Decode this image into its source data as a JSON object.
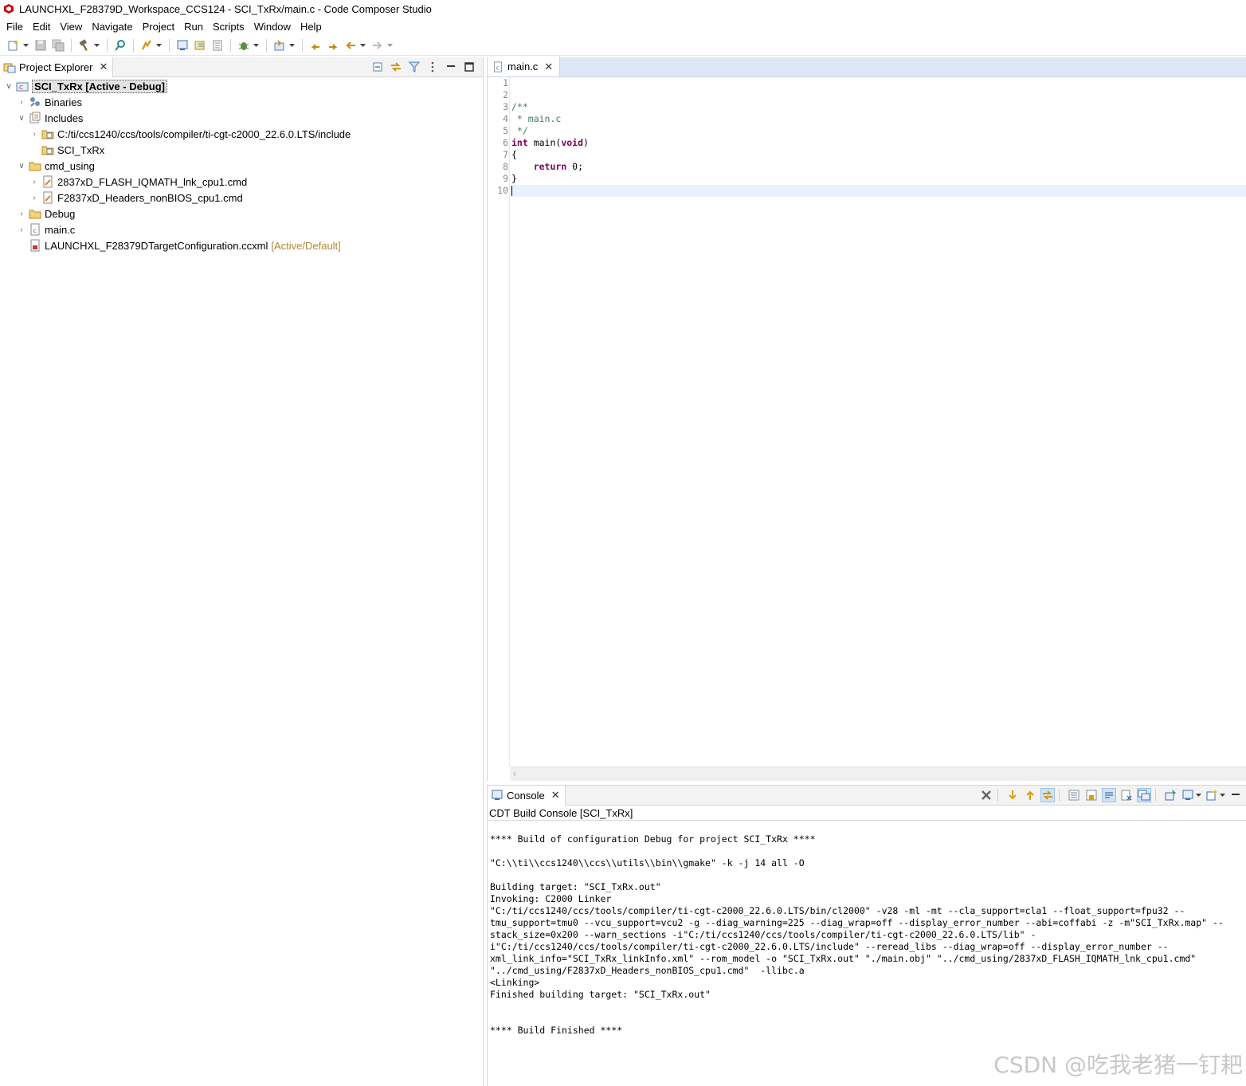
{
  "window": {
    "title": "LAUNCHXL_F28379D_Workspace_CCS124 - SCI_TxRx/main.c - Code Composer Studio"
  },
  "menu": [
    "File",
    "Edit",
    "View",
    "Navigate",
    "Project",
    "Run",
    "Scripts",
    "Window",
    "Help"
  ],
  "project_explorer": {
    "tab_label": "Project Explorer",
    "tree": [
      {
        "label": "SCI_TxRx  [Active - Debug]",
        "icon": "project-icon",
        "expanded": true
      },
      {
        "label": "Binaries",
        "icon": "binaries-icon",
        "expanded": false
      },
      {
        "label": "Includes",
        "icon": "includes-icon",
        "expanded": true
      },
      {
        "label": "C:/ti/ccs1240/ccs/tools/compiler/ti-cgt-c2000_22.6.0.LTS/include",
        "icon": "include-folder-icon",
        "expanded": false
      },
      {
        "label": "SCI_TxRx",
        "icon": "include-folder-icon"
      },
      {
        "label": "cmd_using",
        "icon": "folder-icon",
        "expanded": true
      },
      {
        "label": "2837xD_FLASH_IQMATH_lnk_cpu1.cmd",
        "icon": "cmd-file-icon",
        "expanded": false
      },
      {
        "label": "F2837xD_Headers_nonBIOS_cpu1.cmd",
        "icon": "cmd-file-icon",
        "expanded": false
      },
      {
        "label": "Debug",
        "icon": "folder-icon",
        "expanded": false
      },
      {
        "label": "main.c",
        "icon": "c-file-icon",
        "expanded": false
      },
      {
        "label": "LAUNCHXL_F28379DTargetConfiguration.ccxml",
        "icon": "target-config-icon",
        "decoration": "[Active/Default]"
      }
    ]
  },
  "editor": {
    "tab_label": "main.c",
    "line_numbers": [
      "1",
      "2",
      "3",
      "4",
      "5",
      "6",
      "7",
      "8",
      "9",
      "10"
    ],
    "lines": {
      "l3": "/**",
      "l4": " * main.c",
      "l5": " */",
      "l6_kw": "int",
      "l6_rest": " main(",
      "l6_kw2": "void",
      "l6_end": ")",
      "l7": "{",
      "l8_indent": "    ",
      "l8_kw": "return",
      "l8_rest": " 0;",
      "l9": "}"
    },
    "current_line": 10
  },
  "console": {
    "tab_label": "Console",
    "title": "CDT Build Console [SCI_TxRx]",
    "lines": [
      "**** Build of configuration Debug for project SCI_TxRx ****",
      "",
      "\"C:\\\\ti\\\\ccs1240\\\\ccs\\\\utils\\\\bin\\\\gmake\" -k -j 14 all -O",
      "",
      "Building target: \"SCI_TxRx.out\"",
      "Invoking: C2000 Linker",
      "\"C:/ti/ccs1240/ccs/tools/compiler/ti-cgt-c2000_22.6.0.LTS/bin/cl2000\" -v28 -ml -mt --cla_support=cla1 --float_support=fpu32 --",
      "tmu_support=tmu0 --vcu_support=vcu2 -g --diag_warning=225 --diag_wrap=off --display_error_number --abi=coffabi -z -m\"SCI_TxRx.map\" --",
      "stack_size=0x200 --warn_sections -i\"C:/ti/ccs1240/ccs/tools/compiler/ti-cgt-c2000_22.6.0.LTS/lib\" -",
      "i\"C:/ti/ccs1240/ccs/tools/compiler/ti-cgt-c2000_22.6.0.LTS/include\" --reread_libs --diag_wrap=off --display_error_number --",
      "xml_link_info=\"SCI_TxRx_linkInfo.xml\" --rom_model -o \"SCI_TxRx.out\" \"./main.obj\" \"../cmd_using/2837xD_FLASH_IQMATH_lnk_cpu1.cmd\"",
      "\"../cmd_using/F2837xD_Headers_nonBIOS_cpu1.cmd\"  -llibc.a",
      "<Linking>",
      "Finished building target: \"SCI_TxRx.out\"",
      "",
      "",
      "**** Build Finished ****"
    ]
  },
  "watermark": "CSDN @吃我老猪一钉耙"
}
